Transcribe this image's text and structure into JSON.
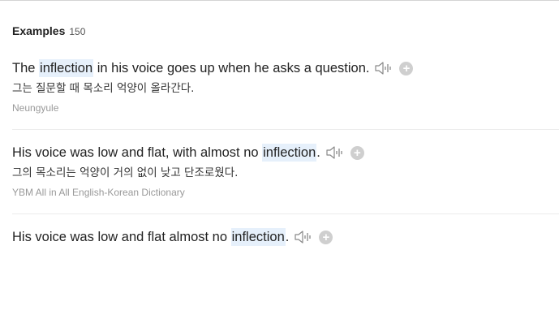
{
  "examples_section": {
    "title": "Examples",
    "count": "150",
    "items": [
      {
        "before": "The ",
        "highlight": "inflection",
        "after": " in his voice goes up when he asks a question.",
        "translation": "그는 질문할 때 목소리 억양이 올라간다.",
        "source": "Neungyule"
      },
      {
        "before": "His voice was low and flat, with almost no ",
        "highlight": "inflection",
        "after": ".",
        "translation": "그의 목소리는 억양이 거의 없이 낮고 단조로웠다.",
        "source": "YBM All in All English-Korean Dictionary"
      },
      {
        "before": "His voice was low and flat almost no ",
        "highlight": "inflection",
        "after": "."
      }
    ]
  },
  "icons": {
    "speaker": "speaker-icon",
    "add": "plus-circle-icon",
    "plus_glyph": "+"
  },
  "colors": {
    "highlight_bg": "#e6f0fb",
    "text": "#222222",
    "source_text": "#999999",
    "add_button_bg": "#cfcfcf"
  }
}
